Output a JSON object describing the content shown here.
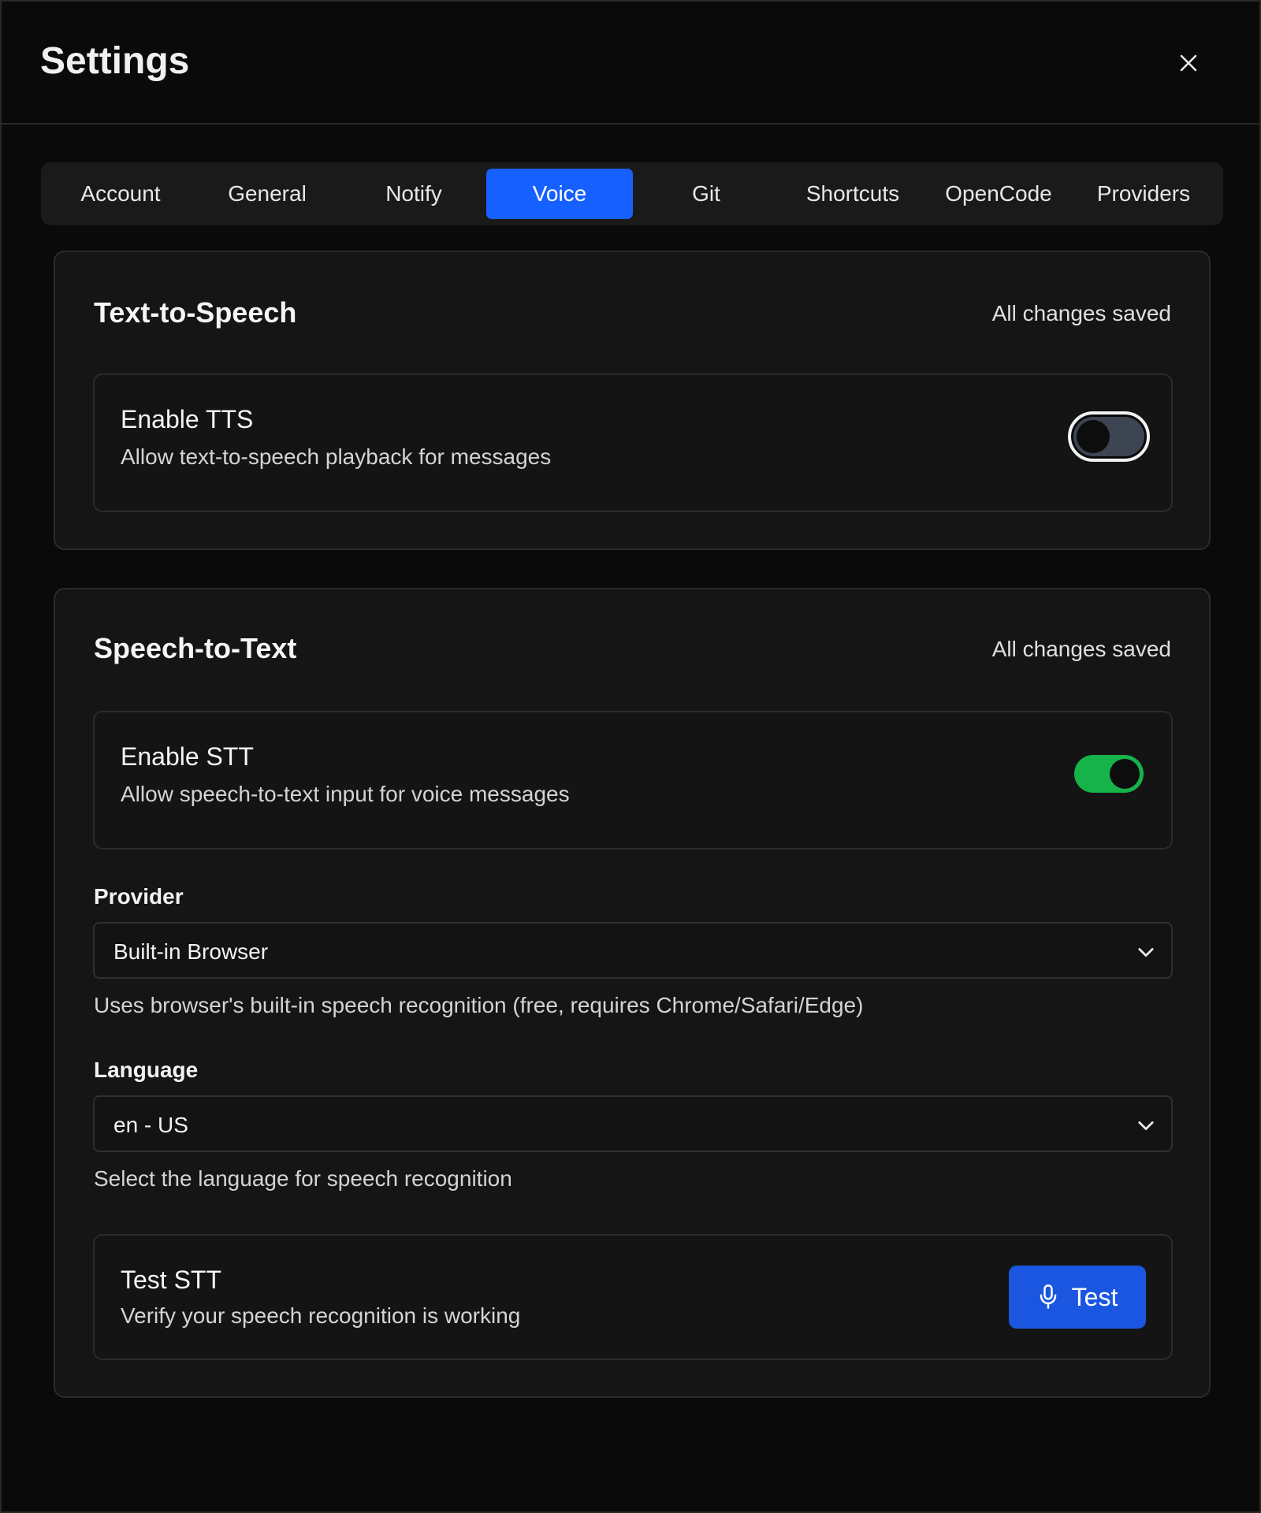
{
  "header": {
    "title": "Settings",
    "close_icon": "close-icon"
  },
  "tabs": [
    {
      "label": "Account",
      "active": false
    },
    {
      "label": "General",
      "active": false
    },
    {
      "label": "Notify",
      "active": false
    },
    {
      "label": "Voice",
      "active": true
    },
    {
      "label": "Git",
      "active": false
    },
    {
      "label": "Shortcuts",
      "active": false
    },
    {
      "label": "OpenCode",
      "active": false
    },
    {
      "label": "Providers",
      "active": false
    }
  ],
  "tts": {
    "title": "Text-to-Speech",
    "status": "All changes saved",
    "enable": {
      "title": "Enable TTS",
      "description": "Allow text-to-speech playback for messages",
      "enabled": false
    }
  },
  "stt": {
    "title": "Speech-to-Text",
    "status": "All changes saved",
    "enable": {
      "title": "Enable STT",
      "description": "Allow speech-to-text input for voice messages",
      "enabled": true
    },
    "provider": {
      "label": "Provider",
      "value": "Built-in Browser",
      "help": "Uses browser's built-in speech recognition (free, requires Chrome/Safari/Edge)"
    },
    "language": {
      "label": "Language",
      "value": "en - US",
      "help": "Select the language for speech recognition"
    },
    "test": {
      "title": "Test STT",
      "description": "Verify your speech recognition is working",
      "button_label": "Test",
      "button_icon": "microphone-icon"
    }
  },
  "colors": {
    "accent": "#1660ff",
    "toggle_on": "#16b24a",
    "background": "#0a0a0a",
    "card": "#151515"
  }
}
